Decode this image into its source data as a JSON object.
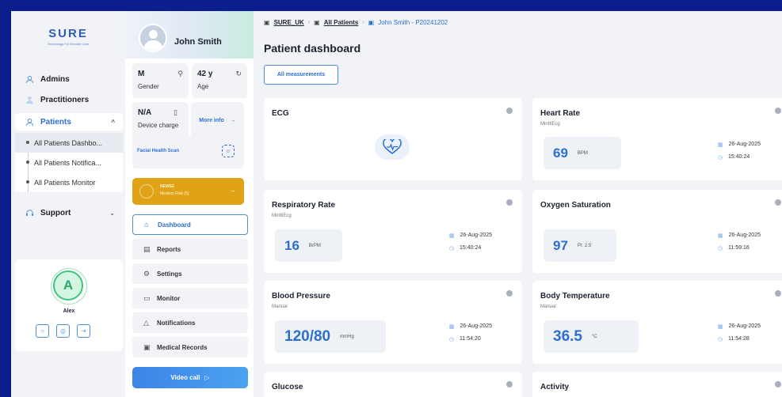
{
  "logo": {
    "title": "SURE",
    "subtitle": "Technology For Remote Care"
  },
  "nav": {
    "items": [
      {
        "label": "Admins"
      },
      {
        "label": "Practitioners"
      },
      {
        "label": "Patients"
      },
      {
        "label": "Support"
      }
    ],
    "sub_items": [
      {
        "label": "All Patients Dashbo..."
      },
      {
        "label": "All Patients Notifica..."
      },
      {
        "label": "All Patients Monitor"
      }
    ]
  },
  "user": {
    "initial": "A",
    "name": "Alex"
  },
  "patient": {
    "name": "John Smith",
    "gender_value": "M",
    "gender_label": "Gender",
    "age_value": "42 y",
    "age_label": "Age",
    "charge_value": "N/A",
    "charge_label": "Device charge",
    "more_info": "More info",
    "facial_scan": "Facial Health Scan",
    "news_title": "NEWS2",
    "news_risk": "Medium Risk (5)"
  },
  "menu": {
    "items": [
      {
        "label": "Dashboard"
      },
      {
        "label": "Reports"
      },
      {
        "label": "Settings"
      },
      {
        "label": "Monitor"
      },
      {
        "label": "Notifications"
      },
      {
        "label": "Medical Records"
      }
    ],
    "video_call": "Video call"
  },
  "breadcrumb": {
    "root": "SURE_UK",
    "section": "All Patients",
    "current": "John Smith - P20241202"
  },
  "page_title": "Patient dashboard",
  "filter_button": "All measurements",
  "cards": {
    "ecg": {
      "title": "ECG"
    },
    "heart_rate": {
      "title": "Heart Rate",
      "source": "MinttiEcg",
      "value": "69",
      "unit": "BPM",
      "date": "26-Aug-2025",
      "time": "15:40:24"
    },
    "respiratory_rate": {
      "title": "Respiratory Rate",
      "source": "MinttiEcg",
      "value": "16",
      "unit": "BrPM",
      "date": "26-Aug-2025",
      "time": "15:40:24"
    },
    "oxygen": {
      "title": "Oxygen Saturation",
      "value": "97",
      "unit": "PI: 2.5",
      "date": "26-Aug-2025",
      "time": "11:59:16"
    },
    "blood_pressure": {
      "title": "Blood Pressure",
      "source": "Manual",
      "value": "120/80",
      "unit": "mmHg",
      "date": "26-Aug-2025",
      "time": "11:54:20"
    },
    "body_temp": {
      "title": "Body Temperature",
      "source": "Manual",
      "value": "36.5",
      "unit": "°C",
      "date": "26-Aug-2025",
      "time": "11:54:28"
    },
    "glucose": {
      "title": "Glucose"
    },
    "activity": {
      "title": "Activity"
    }
  },
  "colors": {
    "frame_bg": "#0b1e8e",
    "accent": "#2d6fcf",
    "news_bg": "#e0a216",
    "avatar_green": "#3cc67a"
  }
}
